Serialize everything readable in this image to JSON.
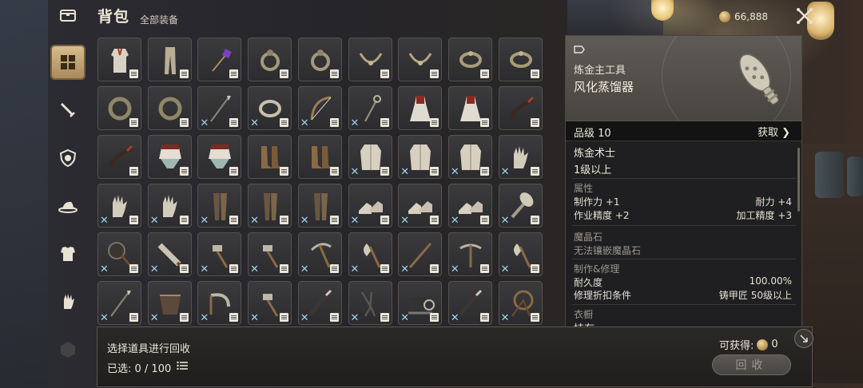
{
  "header": {
    "title": "背包",
    "subtitle": "全部装备"
  },
  "nav": {
    "items": [
      {
        "name": "nav-chest",
        "icon": "chest-icon",
        "active": false
      },
      {
        "name": "nav-all",
        "icon": "grid-icon",
        "active": true
      },
      {
        "name": "nav-sword",
        "icon": "sword-icon",
        "active": false
      },
      {
        "name": "nav-shield",
        "icon": "shield-icon",
        "active": false
      },
      {
        "name": "nav-hat",
        "icon": "hat-icon",
        "active": false
      },
      {
        "name": "nav-armor",
        "icon": "armor-icon",
        "active": false
      },
      {
        "name": "nav-glove",
        "icon": "glove-icon",
        "active": false
      },
      {
        "name": "nav-dice",
        "icon": "dice-icon",
        "active": false
      }
    ]
  },
  "currency": {
    "amount": "66,888",
    "icon": "coin-icon"
  },
  "grid": {
    "rows": [
      [
        {
          "item": "robe",
          "x": false
        },
        {
          "item": "pants",
          "x": false
        },
        {
          "item": "purple-gem-wand",
          "x": false
        },
        {
          "item": "ring",
          "x": false
        },
        {
          "item": "ring",
          "x": false
        },
        {
          "item": "necklace",
          "x": false
        },
        {
          "item": "necklace",
          "x": false
        },
        {
          "item": "bracelet",
          "x": false
        },
        {
          "item": "bracelet",
          "x": false
        }
      ],
      [
        {
          "item": "ring-large",
          "x": false
        },
        {
          "item": "ring-large",
          "x": false
        },
        {
          "item": "spear",
          "x": true
        },
        {
          "item": "bangle",
          "x": true
        },
        {
          "item": "bow",
          "x": true
        },
        {
          "item": "staff",
          "x": true
        },
        {
          "item": "dress",
          "x": false
        },
        {
          "item": "dress",
          "x": false
        },
        {
          "item": "quill",
          "x": false
        }
      ],
      [
        {
          "item": "quill",
          "x": false
        },
        {
          "item": "skirt",
          "x": false
        },
        {
          "item": "skirt",
          "x": false
        },
        {
          "item": "boots",
          "x": false
        },
        {
          "item": "boots",
          "x": false
        },
        {
          "item": "coat",
          "x": true
        },
        {
          "item": "coat",
          "x": true
        },
        {
          "item": "coat",
          "x": true
        },
        {
          "item": "glove",
          "x": true
        }
      ],
      [
        {
          "item": "glove",
          "x": true
        },
        {
          "item": "glove",
          "x": true
        },
        {
          "item": "leggings",
          "x": true
        },
        {
          "item": "leggings",
          "x": true
        },
        {
          "item": "leggings",
          "x": true
        },
        {
          "item": "shoes",
          "x": true
        },
        {
          "item": "shoes",
          "x": true
        },
        {
          "item": "shoes",
          "x": true
        },
        {
          "item": "pestle",
          "x": true
        }
      ],
      [
        {
          "item": "pan",
          "x": true
        },
        {
          "item": "saw",
          "x": true
        },
        {
          "item": "hammer",
          "x": true
        },
        {
          "item": "hammer",
          "x": true
        },
        {
          "item": "pick",
          "x": true
        },
        {
          "item": "axe",
          "x": true
        },
        {
          "item": "rod",
          "x": true
        },
        {
          "item": "pickaxe",
          "x": true
        },
        {
          "item": "axe",
          "x": true
        }
      ],
      [
        {
          "item": "spear",
          "x": true
        },
        {
          "item": "basket",
          "x": true
        },
        {
          "item": "sickle",
          "x": true
        },
        {
          "item": "hammer",
          "x": true
        },
        {
          "item": "knife",
          "x": true
        },
        {
          "item": "tongs",
          "x": true
        },
        {
          "item": "sewing-machine",
          "x": true
        },
        {
          "item": "knife",
          "x": true
        },
        {
          "item": "spinning-wheel",
          "x": true
        }
      ]
    ]
  },
  "detail": {
    "category_icon": "category-tag-icon",
    "category": "炼金主工具",
    "name": "风化蒸馏器",
    "grade": "品级 10",
    "acquire_label": "获取",
    "profession": "炼金术士",
    "level_req": "1级以上",
    "attr_title": "属性",
    "attrs": [
      {
        "l": "制作力",
        "lv": "+1",
        "r": "耐力",
        "rv": "+4"
      },
      {
        "l": "作业精度",
        "lv": "+2",
        "r": "加工精度",
        "rv": "+3"
      }
    ],
    "gem_title": "魔晶石",
    "gem_text": "无法镶嵌魔晶石",
    "repair_title": "制作&修理",
    "durability_label": "耐久度",
    "durability_value": "100.00%",
    "repair_label": "修理折扣条件",
    "repair_value": "铸甲匠 50级以上",
    "wardrobe_title": "衣橱",
    "wardrobe_partial": "持有"
  },
  "bottom": {
    "hint": "选择道具进行回收",
    "selected": "已选: 0 / 100",
    "obtain_label": "可获得:",
    "obtain_value": "0",
    "recycle_label": "回收"
  },
  "colors": {
    "accent": "#c9ab76",
    "x_mark": "#9ed3ef"
  }
}
